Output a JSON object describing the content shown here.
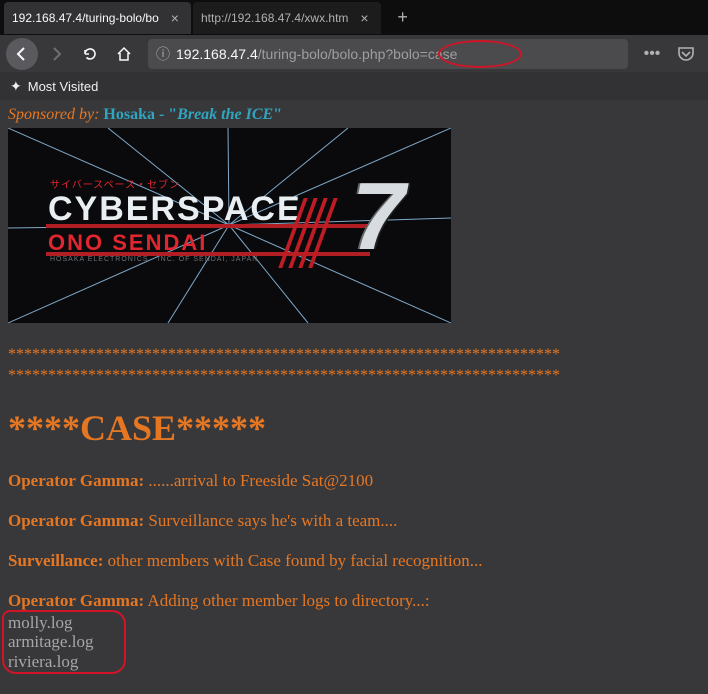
{
  "tabs": [
    {
      "label": "192.168.47.4/turing-bolo/bo",
      "active": true
    },
    {
      "label": "http://192.168.47.4/xwx.htm",
      "active": false
    }
  ],
  "url": {
    "host": "192.168.47.4",
    "path": "/turing-bolo/bolo.php?bolo=case"
  },
  "bookmarks": {
    "mostVisited": "Most Visited"
  },
  "sponsor": {
    "by": "Sponsored by: ",
    "brand": "Hosaka - \"",
    "slogan": "Break the ICE",
    "end": "\""
  },
  "hero": {
    "jp": "サイバースペース・セブン",
    "title": "CYBERSPACE",
    "sub": "ONO SENDAI",
    "foot": "HOSAKA ELECTRONICS · INC. OF SENDAI, JAPAN",
    "seven": "7"
  },
  "starsRow1": "*********************************************************************",
  "starsRow2": "*********************************************************************",
  "caseHeader": "****CASE*****",
  "logs": [
    {
      "who": "Operator Gamma:",
      "msg": " ......arrival to Freeside Sat@2100"
    },
    {
      "who": "Operator Gamma:",
      "msg": " Surveillance says he's with a team...."
    },
    {
      "who": "Surveillance:",
      "msg": " other members with Case found by facial recognition..."
    },
    {
      "who": "Operator Gamma:",
      "msg": " Adding other member logs to directory...:"
    }
  ],
  "files": [
    "molly.log",
    "armitage.log",
    "riviera.log"
  ]
}
